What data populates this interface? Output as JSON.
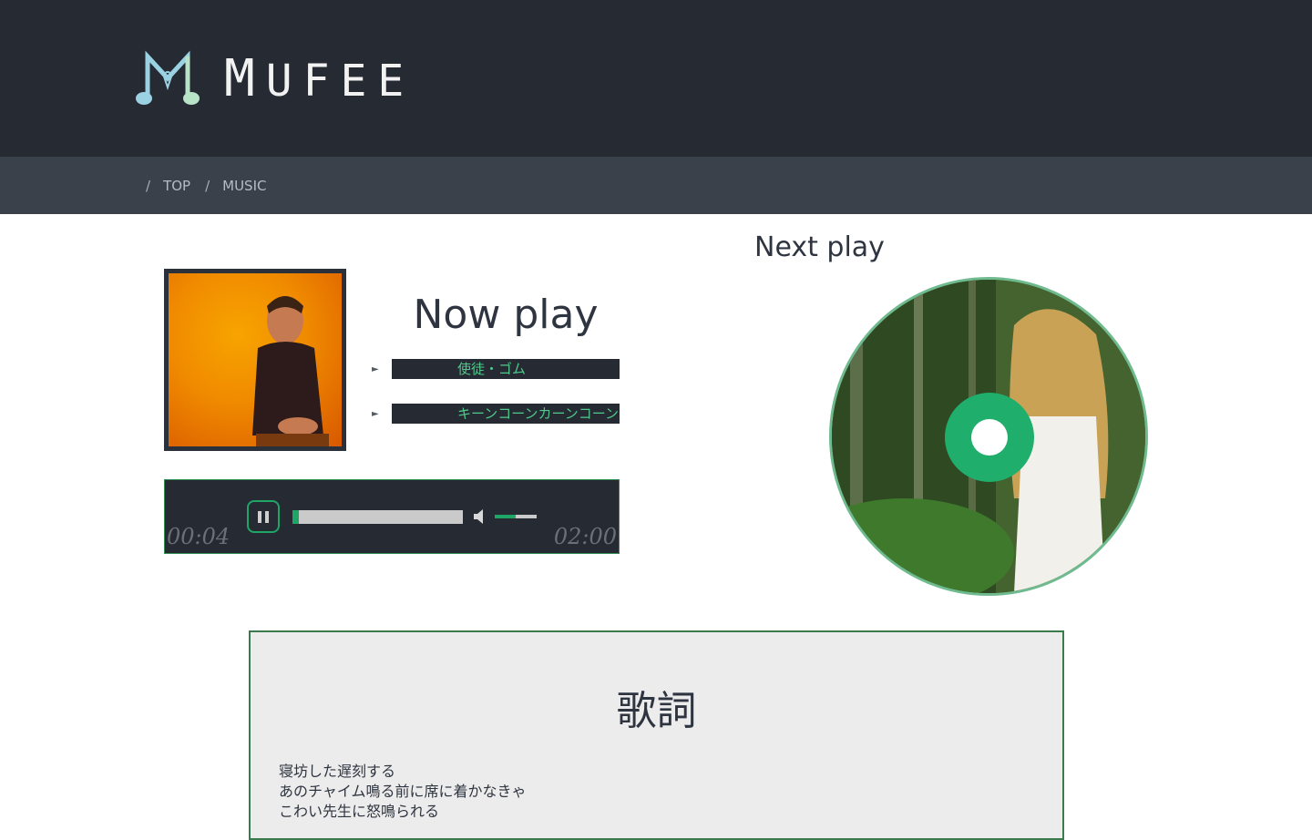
{
  "header": {
    "brand_first": "M",
    "brand_rest": "UFEE",
    "logo_icon": "music-note-logo-icon"
  },
  "breadcrumb": {
    "separator": "/",
    "items": [
      "TOP",
      "MUSIC"
    ]
  },
  "now_play": {
    "title": "Now play",
    "tracks": [
      "使徒・ゴム",
      "キーンコーンカーンコーン"
    ]
  },
  "player": {
    "current_time": "00:04",
    "total_time": "02:00",
    "progress": 0.04,
    "volume": 0.5,
    "icons": [
      "pause-icon",
      "volume-icon"
    ]
  },
  "next_play": {
    "title": "Next play"
  },
  "lyrics": {
    "title": "歌詞",
    "lines": [
      "寝坊した遅刻する",
      "あのチャイム鳴る前に席に着かなきゃ",
      "こわい先生に怒鳴られる"
    ]
  },
  "colors": {
    "header_bg": "#252a33",
    "subnav_bg": "#3a414b",
    "accent_green": "#1fa667"
  }
}
